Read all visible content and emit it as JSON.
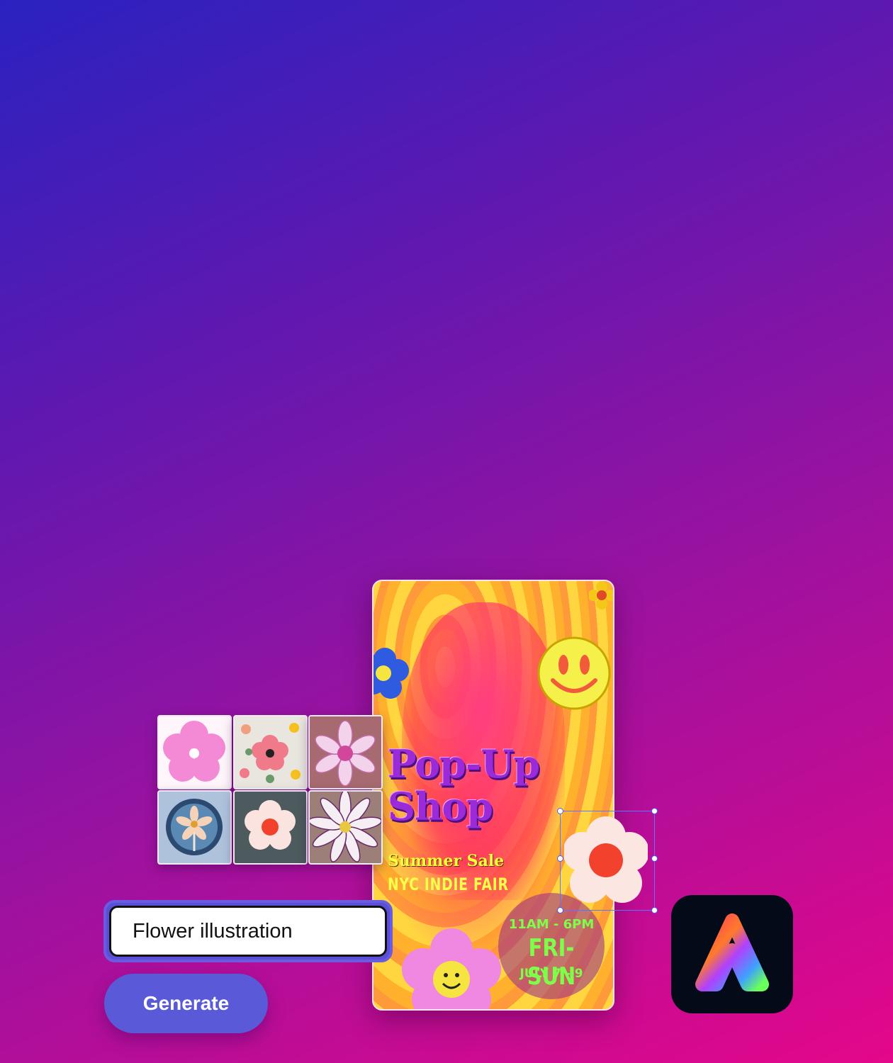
{
  "poster": {
    "title": "Pop-Up\nShop",
    "subtitle": "Summer Sale",
    "event": "NYC INDIE FAIR",
    "time": "11AM - 6PM",
    "days": "FRI-SUN",
    "date": "JULY 7 - 9"
  },
  "thumbnails": [
    {
      "icon": "pink-flower-icon"
    },
    {
      "icon": "floral-pattern-icon"
    },
    {
      "icon": "3d-daisy-icon"
    },
    {
      "icon": "badge-flower-icon"
    },
    {
      "icon": "white-flower-icon"
    },
    {
      "icon": "striped-daisy-icon"
    }
  ],
  "prompt": {
    "value": "Flower illustration"
  },
  "generate": {
    "label": "Generate"
  },
  "colors": {
    "accent": "#5a5ad8",
    "selection": "#5d74ff"
  }
}
